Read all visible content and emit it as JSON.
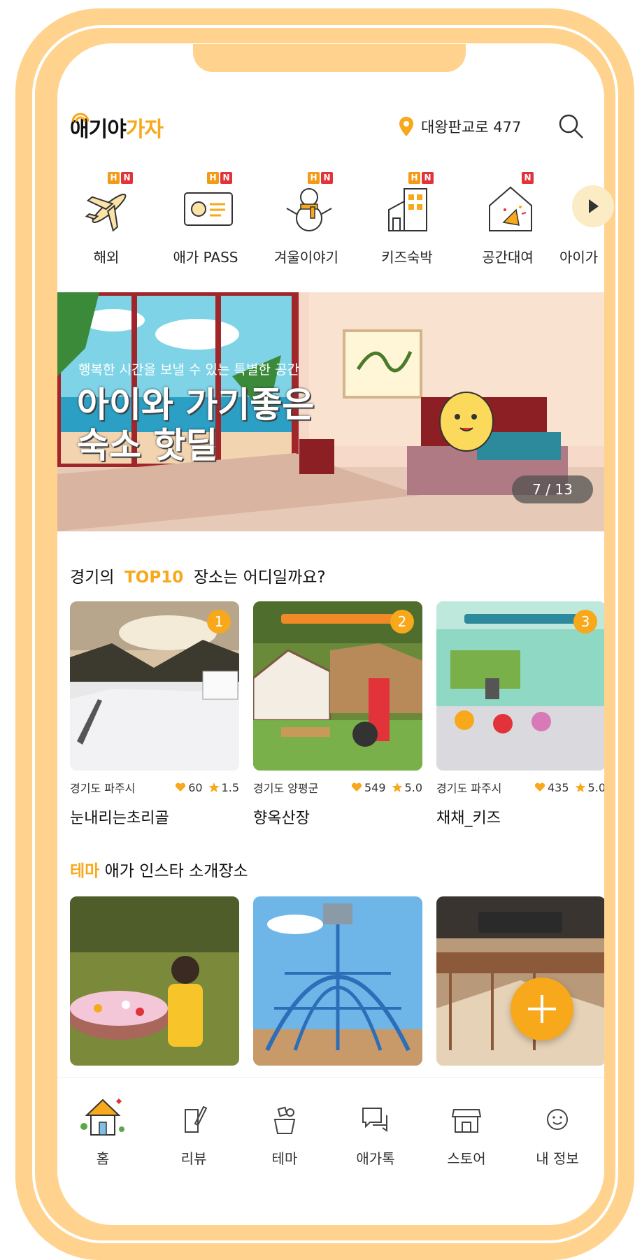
{
  "app": {
    "logo_part1": "애기야",
    "logo_part2": "가자"
  },
  "header": {
    "location": "대왕판교로 477"
  },
  "categories": [
    {
      "label": "해외",
      "badges": [
        "H",
        "N"
      ]
    },
    {
      "label": "애가 PASS",
      "badges": [
        "H",
        "N"
      ]
    },
    {
      "label": "겨울이야기",
      "badges": [
        "H",
        "N"
      ]
    },
    {
      "label": "키즈숙박",
      "badges": [
        "H",
        "N"
      ]
    },
    {
      "label": "공간대여",
      "badges": [
        "N"
      ]
    },
    {
      "label": "아이가"
    }
  ],
  "banner": {
    "subtitle": "행복한 시간을 보낼 수 있는 특별한 공간",
    "title": "아이와 가기좋은\n숙소 핫딜",
    "counter": "7 / 13"
  },
  "top10": {
    "prefix": "경기의",
    "highlight": "TOP10",
    "suffix": "장소는 어디일까요?",
    "items": [
      {
        "rank": "1",
        "region": "경기도 파주시",
        "likes": "60",
        "rating": "1.5",
        "name": "눈내리는초리골"
      },
      {
        "rank": "2",
        "region": "경기도 양평군",
        "likes": "549",
        "rating": "5.0",
        "name": "향옥산장"
      },
      {
        "rank": "3",
        "region": "경기도 파주시",
        "likes": "435",
        "rating": "5.0",
        "name": "채채_키즈"
      }
    ]
  },
  "theme": {
    "highlight": "테마",
    "suffix": "애가 인스타 소개장소"
  },
  "tabs": [
    {
      "label": "홈",
      "icon": "home-icon"
    },
    {
      "label": "리뷰",
      "icon": "review-icon"
    },
    {
      "label": "테마",
      "icon": "theme-icon"
    },
    {
      "label": "애가톡",
      "icon": "chat-icon"
    },
    {
      "label": "스토어",
      "icon": "store-icon"
    },
    {
      "label": "내 정보",
      "icon": "profile-icon"
    }
  ],
  "colors": {
    "accent": "#f7a81b",
    "frame": "#ffd38d",
    "badge_h": "#f39a17",
    "badge_n": "#e2323a"
  }
}
